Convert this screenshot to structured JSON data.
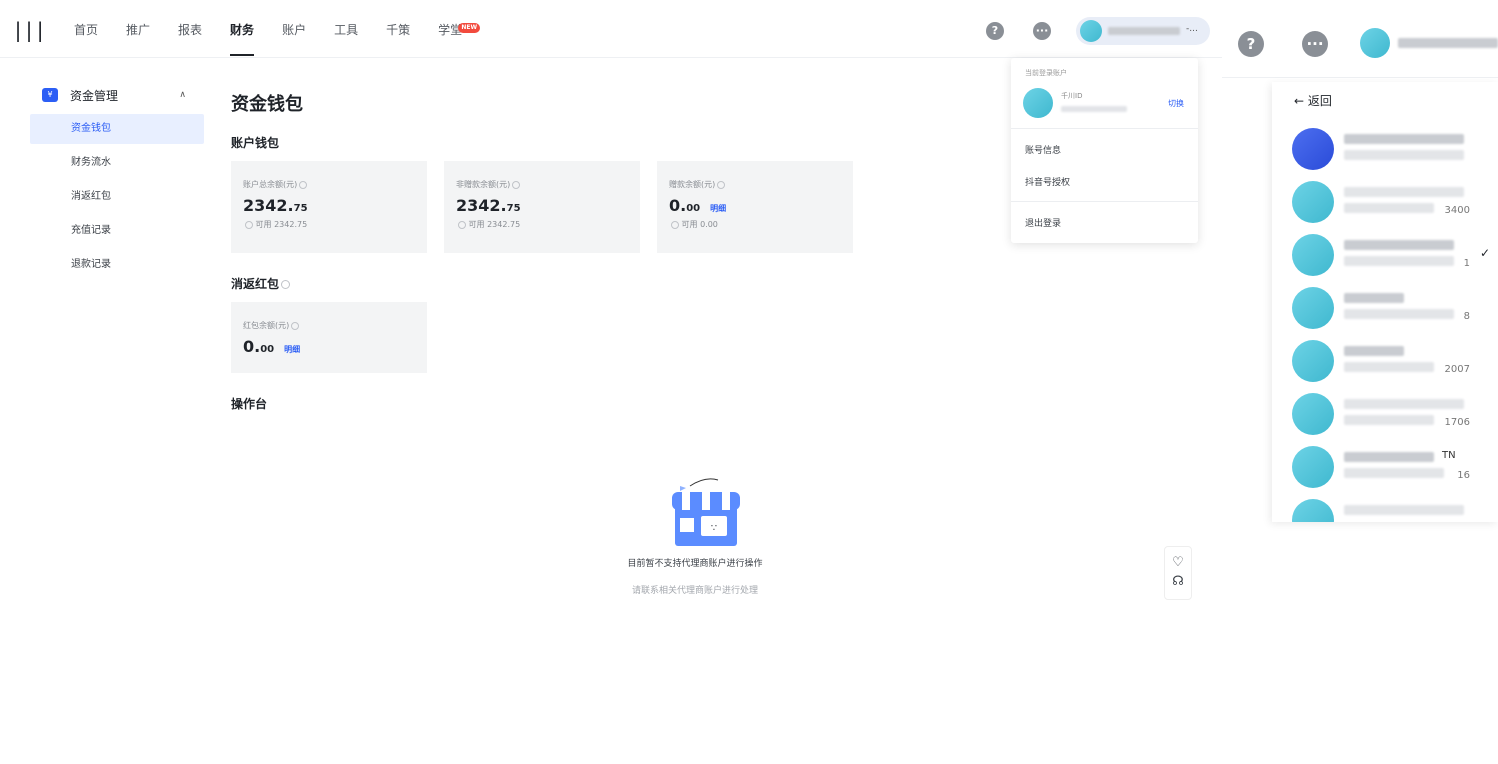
{
  "logo": "|||",
  "nav": [
    "首页",
    "推广",
    "报表",
    "财务",
    "账户",
    "工具",
    "千策",
    "学堂"
  ],
  "nav_active_index": 3,
  "nav_badge": "NEW",
  "header": {
    "help_icon": "?",
    "user_tail": "-..."
  },
  "sidebar": {
    "section": "资金管理",
    "items": [
      "资金钱包",
      "财务流水",
      "消返红包",
      "充值记录",
      "退款记录"
    ]
  },
  "main": {
    "title": "资金钱包",
    "wallet_heading": "账户钱包",
    "cards": [
      {
        "label": "账户总余额(元)",
        "int": "2342.",
        "dec": "75",
        "sub": "可用 2342.75",
        "link": ""
      },
      {
        "label": "非赠款余额(元)",
        "int": "2342.",
        "dec": "75",
        "sub": "可用 2342.75",
        "link": ""
      },
      {
        "label": "赠款余额(元)",
        "int": "0.",
        "dec": "00",
        "sub": "可用 0.00",
        "link": "明细"
      }
    ],
    "redpack_heading": "消返红包",
    "redpack_card": {
      "label": "红包余额(元)",
      "int": "0.",
      "dec": "00",
      "link": "明细"
    },
    "console_heading": "操作台",
    "empty_msg": "目前暂不支持代理商账户进行操作",
    "empty_hint": "请联系相关代理商账户进行处理"
  },
  "dropdown": {
    "label": "当前登录账户",
    "qid": "千川ID",
    "switch": "切换",
    "items": [
      "账号信息",
      "抖音号授权",
      "退出登录"
    ]
  },
  "panel": {
    "back": "返回",
    "accounts": [
      {
        "name": "",
        "tail": ""
      },
      {
        "name": "",
        "tail": "3400"
      },
      {
        "name": "",
        "tail": "1"
      },
      {
        "name": "",
        "tail": "8"
      },
      {
        "name": "",
        "tail": "2007"
      },
      {
        "name": "",
        "tail": "1706"
      },
      {
        "name": "TN",
        "tail": "16"
      },
      {
        "name": "",
        "tail": ""
      }
    ],
    "checked_index": 2
  },
  "colors": {
    "accent": "#2c5ef5",
    "avatar": "#3fb8cf",
    "card_bg": "#f3f4f5"
  }
}
